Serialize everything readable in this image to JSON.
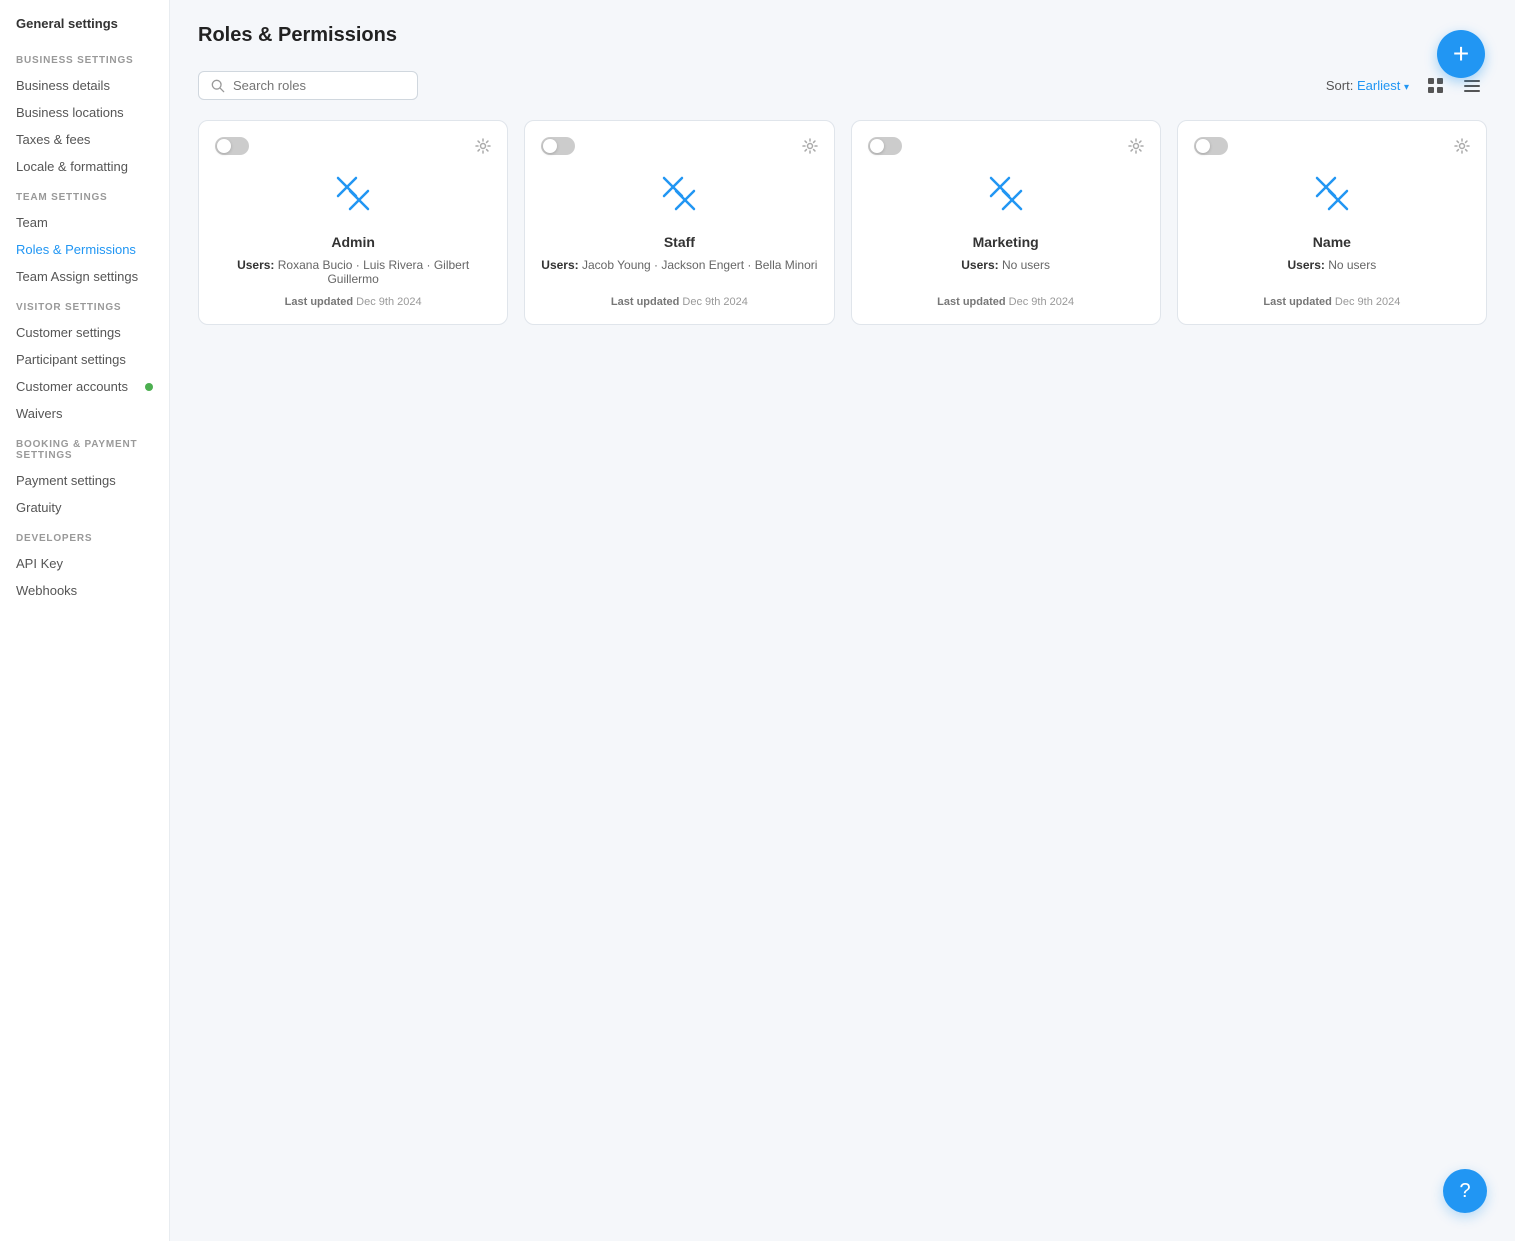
{
  "sidebar": {
    "title": "General settings",
    "sections": [
      {
        "label": "Business Settings",
        "items": [
          {
            "id": "business-details",
            "label": "Business details",
            "active": false
          },
          {
            "id": "business-locations",
            "label": "Business locations",
            "active": false
          },
          {
            "id": "taxes-fees",
            "label": "Taxes & fees",
            "active": false
          },
          {
            "id": "locale-formatting",
            "label": "Locale & formatting",
            "active": false
          }
        ]
      },
      {
        "label": "Team Settings",
        "items": [
          {
            "id": "team",
            "label": "Team",
            "active": false
          },
          {
            "id": "roles-permissions",
            "label": "Roles & Permissions",
            "active": true
          },
          {
            "id": "team-assign-settings",
            "label": "Team Assign settings",
            "active": false
          }
        ]
      },
      {
        "label": "Visitor Settings",
        "items": [
          {
            "id": "customer-settings",
            "label": "Customer settings",
            "active": false
          },
          {
            "id": "participant-settings",
            "label": "Participant settings",
            "active": false
          },
          {
            "id": "customer-accounts",
            "label": "Customer accounts",
            "active": false,
            "dot": true
          },
          {
            "id": "waivers",
            "label": "Waivers",
            "active": false
          }
        ]
      },
      {
        "label": "Booking & Payment Settings",
        "items": [
          {
            "id": "payment-settings",
            "label": "Payment settings",
            "active": false
          },
          {
            "id": "gratuity",
            "label": "Gratuity",
            "active": false
          }
        ]
      },
      {
        "label": "Developers",
        "items": [
          {
            "id": "api-key",
            "label": "API Key",
            "active": false
          },
          {
            "id": "webhooks",
            "label": "Webhooks",
            "active": false
          }
        ]
      }
    ]
  },
  "page": {
    "title": "Roles & Permissions"
  },
  "toolbar": {
    "search_placeholder": "Search roles",
    "sort_label": "Sort:",
    "sort_value": "Earliest",
    "add_label": "+"
  },
  "roles": [
    {
      "id": "admin",
      "name": "Admin",
      "users_label": "Users:",
      "users": "Roxana Bucio · Luis Rivera · Gilbert Guillermo",
      "last_updated_label": "Last updated",
      "last_updated": "Dec 9th 2024",
      "enabled": false
    },
    {
      "id": "staff",
      "name": "Staff",
      "users_label": "Users:",
      "users": "Jacob Young · Jackson Engert · Bella Minori",
      "last_updated_label": "Last updated",
      "last_updated": "Dec 9th 2024",
      "enabled": false
    },
    {
      "id": "marketing",
      "name": "Marketing",
      "users_label": "Users:",
      "users": "No users",
      "last_updated_label": "Last updated",
      "last_updated": "Dec 9th 2024",
      "enabled": false
    },
    {
      "id": "name",
      "name": "Name",
      "users_label": "Users:",
      "users": "No users",
      "last_updated_label": "Last updated",
      "last_updated": "Dec 9th 2024",
      "enabled": false
    }
  ],
  "help_label": "?",
  "icons": {
    "search": "🔍",
    "gear": "⚙",
    "grid_view": "grid",
    "list_view": "list",
    "wrench": "wrench-cross"
  }
}
